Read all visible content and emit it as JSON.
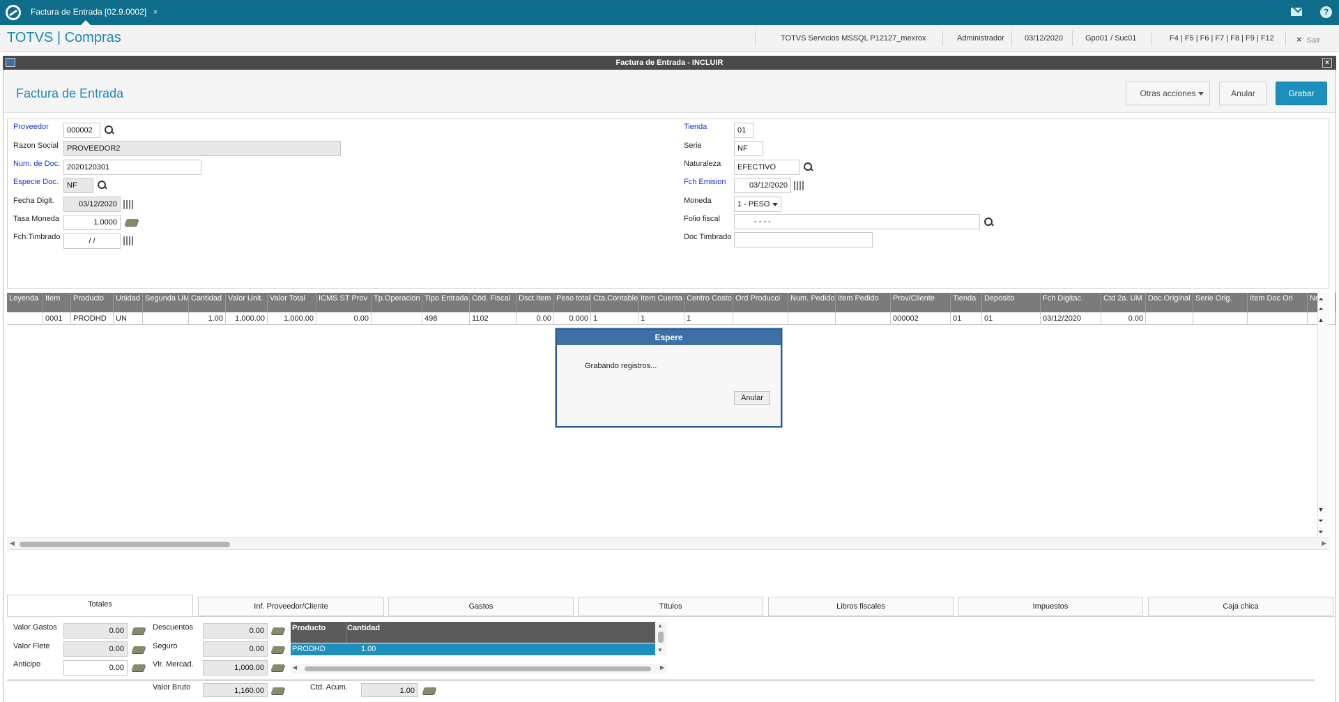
{
  "browser": {
    "tab_label": "Factura de Entrada [02.9.0002]",
    "tab_close": "×"
  },
  "app": {
    "title": "TOTVS | Compras",
    "server": "TOTVS Servicios MSSQL P12127_mexrox",
    "user": "Administrador",
    "date": "03/12/2020",
    "branch": "Gpo01 / Suc01",
    "shortcuts": "F4 | F5 | F6 | F7 | F8 | F9 | F12",
    "exit_label": "Sair"
  },
  "window": {
    "title": "Factura de Entrada - INCLUIR",
    "close": "×"
  },
  "form": {
    "title": "Factura de Entrada",
    "buttons": {
      "other_actions": "Otras acciones",
      "cancel": "Anular",
      "save": "Grabar"
    },
    "left": {
      "proveedor_label": "Proveedor",
      "proveedor_value": "000002",
      "razon_label": "Razon Social",
      "razon_value": "PROVEEDOR2",
      "numdoc_label": "Num. de Doc.",
      "numdoc_value": "2020120301",
      "especie_label": "Especie Doc.",
      "especie_value": "NF",
      "fechadigit_label": "Fecha Digit.",
      "fechadigit_value": "03/12/2020",
      "tasa_label": "Tasa Moneda",
      "tasa_value": "1.0000",
      "fchtimbrado_label": "Fch.Timbrado",
      "fchtimbrado_value": " /  /"
    },
    "right": {
      "tienda_label": "Tienda",
      "tienda_value": "01",
      "serie_label": "Serie",
      "serie_value": "NF",
      "naturaleza_label": "Naturaleza",
      "naturaleza_value": "EFECTIVO",
      "fchemision_label": "Fch Emision",
      "fchemision_value": "03/12/2020",
      "moneda_label": "Moneda",
      "moneda_value": "1 - PESO",
      "folio_label": "Folio fiscal",
      "folio_value": "- - - -",
      "doctimbrado_label": "Doc Timbrado",
      "doctimbrado_value": ""
    }
  },
  "grid": {
    "columns": [
      "Leyenda",
      "Item",
      "Producto",
      "Unidad",
      "Segunda UM",
      "Cantidad",
      "Valor Unit.",
      "Valor Total",
      "ICMS ST Prov",
      "Tp.Operacion",
      "Tipo Entrada",
      "Cód. Fiscal",
      "Dsct.Item",
      "Peso total",
      "Cta.Contable",
      "Item Cuenta",
      "Centro Costo",
      "Ord Producci",
      "Num. Pedido",
      "Item Pedido",
      "Prov/Cliente",
      "Tienda",
      "Deposito",
      "Fch Digitac.",
      "Ctd 2a. UM",
      "Doc.Original",
      "Serie Orig.",
      "Item Doc Ori",
      "Nro.C"
    ],
    "rows": [
      [
        "",
        "0001",
        "PRODHD",
        "UN",
        "",
        "1.00",
        "1,000.00",
        "1,000.00",
        "0.00",
        "",
        "498",
        "1102",
        "0.00",
        "0.000",
        "1",
        "1",
        "1",
        "",
        "",
        "",
        "000002",
        "01",
        "01",
        "03/12/2020",
        "0.00",
        "",
        "",
        "",
        ""
      ]
    ]
  },
  "modal": {
    "title": "Espere",
    "message": "Grabando registros...",
    "cancel": "Anular"
  },
  "tabs": [
    "Totales",
    "Inf. Proveedor/Cliente",
    "Gastos",
    "Títulos",
    "Libros fiscales",
    "Impuestos",
    "Caja chica"
  ],
  "totals": {
    "valor_gastos_label": "Valor Gastos",
    "valor_gastos": "0.00",
    "valor_flete_label": "Valor Flete",
    "valor_flete": "0.00",
    "anticipo_label": "Anticipo",
    "anticipo": "0.00",
    "descuentos_label": "Descuentos",
    "descuentos": "0.00",
    "seguro_label": "Seguro",
    "seguro": "0.00",
    "vlr_mercad_label": "Vlr. Mercad.",
    "vlr_mercad": "1,000.00",
    "valor_bruto_label": "Valor Bruto",
    "valor_bruto": "1,160.00",
    "ctd_acum_label": "Ctd. Acum.",
    "ctd_acum": "1.00"
  },
  "summary_grid": {
    "columns": [
      "Producto",
      "Cantidad"
    ],
    "row": [
      "PRODHD",
      "1.00"
    ]
  }
}
